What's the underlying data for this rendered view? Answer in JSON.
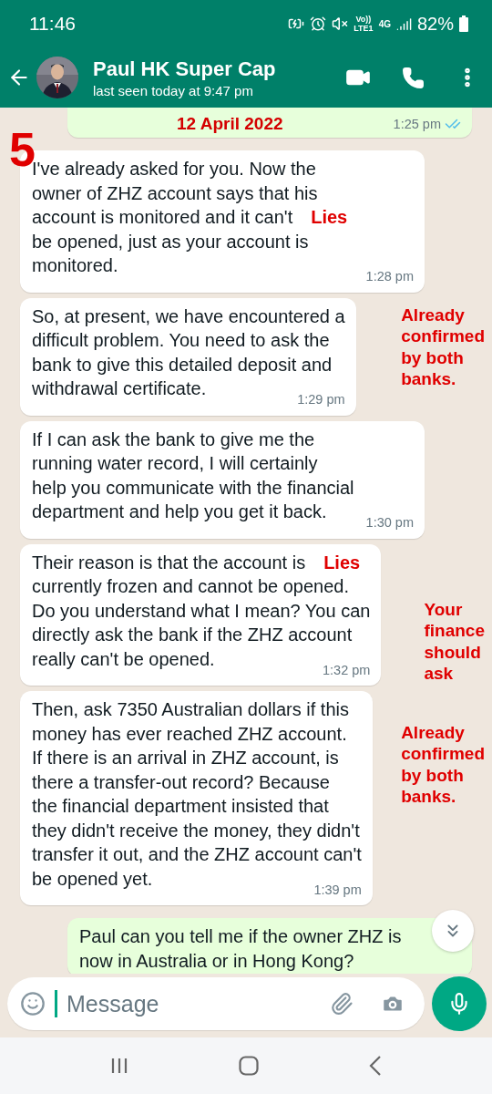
{
  "status_bar": {
    "time": "11:46",
    "network": [
      "Vo))",
      "LTE1",
      "4G"
    ],
    "battery": "82%"
  },
  "header": {
    "name": "Paul HK Super Cap",
    "status": "last seen today at 9:47 pm"
  },
  "page_mark": "5",
  "messages": [
    {
      "kind": "outgoing",
      "overlay": "12 April 2022",
      "time": "1:25 pm",
      "read": true
    },
    {
      "kind": "incoming",
      "lines": [
        {
          "text": "I've already asked for you. Now the"
        },
        {
          "text": "owner of ZHZ account says that his"
        },
        {
          "text": "account is monitored and it can't",
          "note": "Lies"
        },
        {
          "text": "be opened, just as your account is"
        },
        {
          "text": "monitored."
        }
      ],
      "time": "1:28 pm"
    },
    {
      "kind": "incoming",
      "lines": [
        {
          "text": "So, at present, we have encountered a",
          "side": [
            "Already",
            "confirmed",
            "by both",
            "banks."
          ]
        },
        {
          "text": "difficult problem. You need to ask the"
        },
        {
          "text": "bank to give this detailed deposit and"
        },
        {
          "text": "withdrawal certificate."
        }
      ],
      "time": "1:29 pm"
    },
    {
      "kind": "incoming",
      "lines": [
        {
          "text": "If I can ask the bank to give me the"
        },
        {
          "text": "running water record, I will certainly"
        },
        {
          "text": "help you communicate with the financial"
        },
        {
          "text": "department and help you get it back."
        }
      ],
      "time": "1:30 pm"
    },
    {
      "kind": "incoming",
      "lines": [
        {
          "text": "Their reason is that the account is",
          "note": "Lies"
        },
        {
          "text": "currently frozen and cannot be opened."
        },
        {
          "text": "Do you understand what I mean? You can",
          "side": [
            "Your",
            "finance",
            "should",
            "ask"
          ]
        },
        {
          "text": "directly ask the bank if the ZHZ account"
        },
        {
          "text": "really can't be opened."
        }
      ],
      "time": "1:32 pm"
    },
    {
      "kind": "incoming",
      "lines": [
        {
          "text": "Then, ask 7350 Australian dollars if this"
        },
        {
          "text": "money has ever reached ZHZ account.",
          "side": [
            "Already",
            "confirmed",
            "by both",
            "banks."
          ]
        },
        {
          "text": "If there is an arrival in ZHZ account, is"
        },
        {
          "text": "there a transfer-out record? Because"
        },
        {
          "text": "the financial department insisted that"
        },
        {
          "text": "they didn't receive the money, they didn't"
        },
        {
          "text": "transfer it out, and the ZHZ account can't"
        },
        {
          "text": "be opened yet."
        }
      ],
      "time": "1:39 pm"
    },
    {
      "kind": "outgoing",
      "lines": [
        {
          "text": "Paul can you tell me if the owner ZHZ is"
        },
        {
          "text": "now in Australia or in Hong Kong?"
        }
      ]
    }
  ],
  "composer": {
    "placeholder": "Message"
  }
}
